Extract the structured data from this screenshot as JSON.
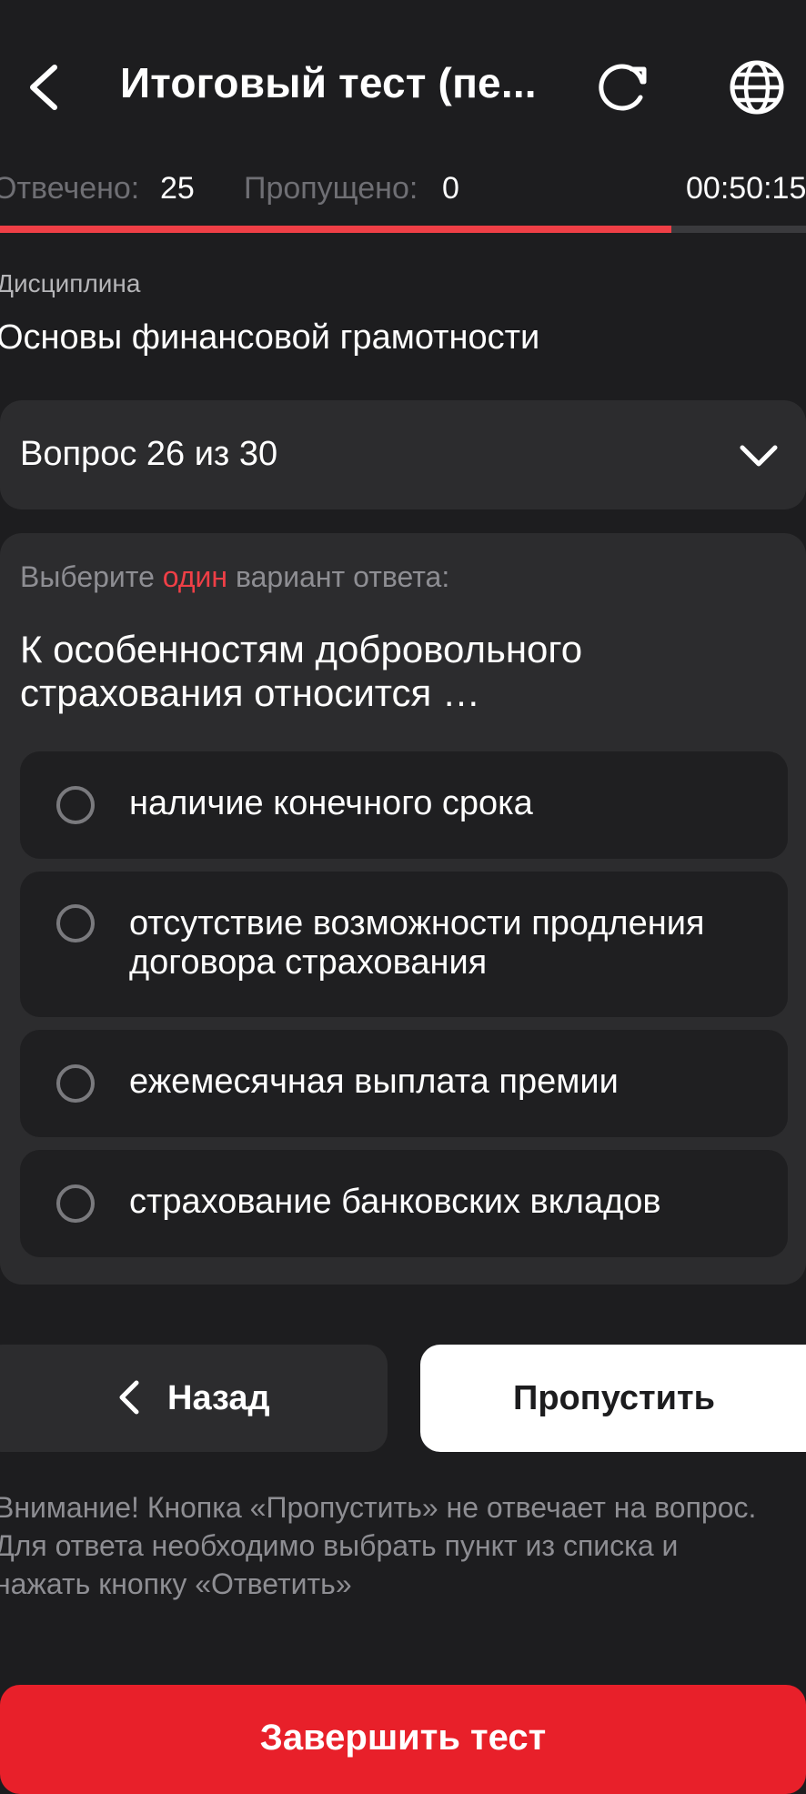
{
  "header": {
    "title": "Итоговый тест (пе...",
    "back_icon": "chevron-left-icon",
    "refresh_icon": "refresh-icon",
    "language_icon": "globe-icon"
  },
  "stats": {
    "answered_label": "Отвечено:",
    "answered_value": "25",
    "skipped_label": "Пропущено:",
    "skipped_value": "0",
    "timer": "00:50:15"
  },
  "progress": {
    "answered": 25,
    "total": 30,
    "fraction": 0.833,
    "color": "#ef3f46"
  },
  "discipline": {
    "label": "Дисциплина",
    "name": "Основы финансовой грамотности"
  },
  "question_selector": {
    "label": "Вопрос 26 из 30",
    "icon": "chevron-down-icon"
  },
  "question": {
    "instruction_before": "Выберите ",
    "instruction_accent": "один",
    "instruction_after": " вариант ответа:",
    "text": "К особенностям добровольного страхования относится …",
    "options": [
      {
        "text": "наличие конечного срока",
        "selected": false
      },
      {
        "text": "отсутствие возможности продления договора страхования",
        "selected": false
      },
      {
        "text": "ежемесячная выплата премии",
        "selected": false
      },
      {
        "text": "страхование банковских вкладов",
        "selected": false
      }
    ]
  },
  "buttons": {
    "back_label": "Назад",
    "skip_label": "Пропустить",
    "finish_label": "Завершить тест"
  },
  "note": "Внимание! Кнопка «Пропустить» не отвечает на вопрос. Для ответа необходимо выбрать пункт из списка и нажать кнопку «Ответить»",
  "colors": {
    "background": "#1d1d1f",
    "accent": "#ef3f46",
    "finish_button": "#e8202a"
  }
}
